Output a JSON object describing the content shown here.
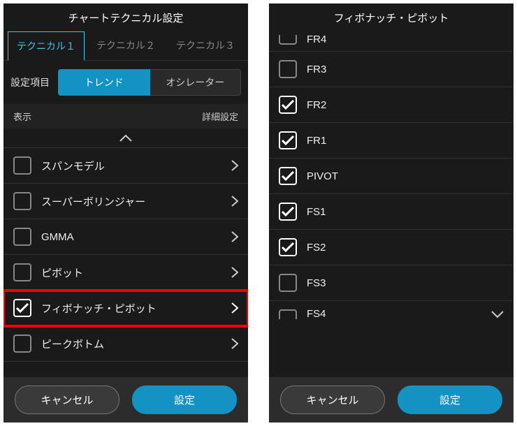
{
  "left": {
    "title": "チャートテクニカル設定",
    "tabs": [
      "テクニカル１",
      "テクニカル２",
      "テクニカル３"
    ],
    "segment_label": "設定項目",
    "segments": [
      "トレンド",
      "オシレーター"
    ],
    "header_left": "表示",
    "header_right": "詳細設定",
    "items": [
      {
        "label": "スパンモデル",
        "checked": false
      },
      {
        "label": "スーパーボリンジャー",
        "checked": false
      },
      {
        "label": "GMMA",
        "checked": false
      },
      {
        "label": "ピボット",
        "checked": false
      },
      {
        "label": "フィボナッチ・ピボット",
        "checked": true,
        "highlight": true
      },
      {
        "label": "ピークボトム",
        "checked": false
      }
    ]
  },
  "right": {
    "title": "フィボナッチ・ピボット",
    "items": [
      {
        "label": "FR4",
        "checked": false
      },
      {
        "label": "FR3",
        "checked": false
      },
      {
        "label": "FR2",
        "checked": true
      },
      {
        "label": "FR1",
        "checked": true
      },
      {
        "label": "PIVOT",
        "checked": true
      },
      {
        "label": "FS1",
        "checked": true
      },
      {
        "label": "FS2",
        "checked": true
      },
      {
        "label": "FS3",
        "checked": false
      },
      {
        "label": "FS4",
        "checked": false
      }
    ]
  },
  "footer": {
    "cancel": "キャンセル",
    "confirm": "設定"
  }
}
